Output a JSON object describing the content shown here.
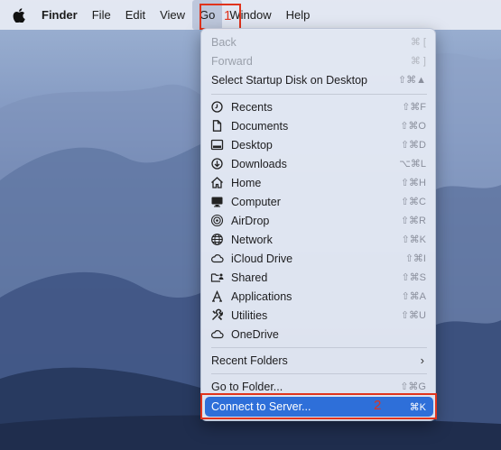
{
  "menubar": {
    "items": [
      "Finder",
      "File",
      "Edit",
      "View",
      "Go",
      "Window",
      "Help"
    ]
  },
  "annotations": {
    "go_marker": "1",
    "connect_marker": "2",
    "color": "#e0331c"
  },
  "go_menu": {
    "top_items": [
      {
        "label": "Back",
        "shortcut": "⌘ [",
        "disabled": true
      },
      {
        "label": "Forward",
        "shortcut": "⌘ ]",
        "disabled": true
      },
      {
        "label": "Select Startup Disk on Desktop",
        "shortcut": "⇧⌘▲",
        "disabled": false
      }
    ],
    "places": [
      {
        "label": "Recents",
        "shortcut": "⇧⌘F",
        "icon": "clock-icon"
      },
      {
        "label": "Documents",
        "shortcut": "⇧⌘O",
        "icon": "document-icon"
      },
      {
        "label": "Desktop",
        "shortcut": "⇧⌘D",
        "icon": "desktop-icon"
      },
      {
        "label": "Downloads",
        "shortcut": "⌥⌘L",
        "icon": "download-icon"
      },
      {
        "label": "Home",
        "shortcut": "⇧⌘H",
        "icon": "home-icon"
      },
      {
        "label": "Computer",
        "shortcut": "⇧⌘C",
        "icon": "computer-icon"
      },
      {
        "label": "AirDrop",
        "shortcut": "⇧⌘R",
        "icon": "airdrop-icon"
      },
      {
        "label": "Network",
        "shortcut": "⇧⌘K",
        "icon": "network-icon"
      },
      {
        "label": "iCloud Drive",
        "shortcut": "⇧⌘I",
        "icon": "cloud-icon"
      },
      {
        "label": "Shared",
        "shortcut": "⇧⌘S",
        "icon": "shared-folder-icon"
      },
      {
        "label": "Applications",
        "shortcut": "⇧⌘A",
        "icon": "applications-icon"
      },
      {
        "label": "Utilities",
        "shortcut": "⇧⌘U",
        "icon": "utilities-icon"
      },
      {
        "label": "OneDrive",
        "shortcut": "",
        "icon": "cloud-icon"
      }
    ],
    "recent_folders": "Recent Folders",
    "go_to_folder": {
      "label": "Go to Folder...",
      "shortcut": "⇧⌘G"
    },
    "connect_to_server": {
      "label": "Connect to Server...",
      "shortcut": "⌘K"
    },
    "accent_color": "#2e6fd9"
  }
}
